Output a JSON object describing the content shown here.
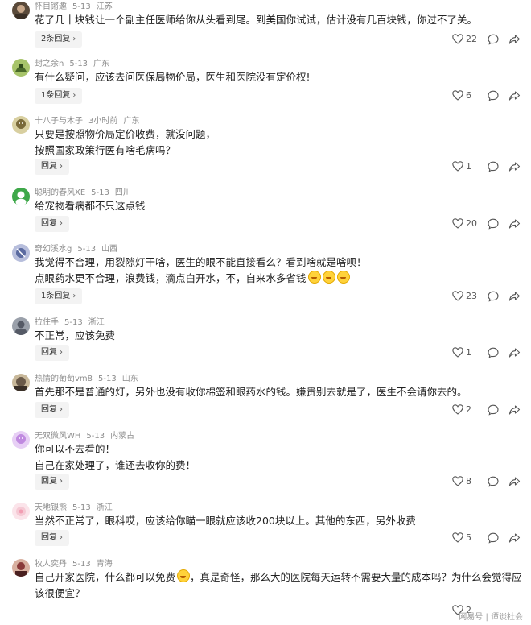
{
  "comments": [
    {
      "user": "怀目锵邀",
      "time": "5-13",
      "region": "江苏",
      "lines": [
        "花了几十块钱让一个副主任医师给你从头看到尾。到美国你试试，估计没有几百块钱，你过不了关。"
      ],
      "reply_label": "2条回复",
      "likes": "22",
      "avatar_color": "#5a4a3a"
    },
    {
      "user": "封之余n",
      "time": "5-13",
      "region": "广东",
      "lines": [
        "有什么疑问，应该去问医保局物价局，医生和医院没有定价权!"
      ],
      "reply_label": "1条回复",
      "likes": "6",
      "avatar_color": "#6b8e3a"
    },
    {
      "user": "十八子与木子",
      "time": "3小时前",
      "region": "广东",
      "lines": [
        "只要是按照物价局定价收费，就没问题，",
        "按照国家政策行医有啥毛病吗？"
      ],
      "reply_label": "回复",
      "likes": "1",
      "avatar_color": "#7a6a3a"
    },
    {
      "user": "聪明的春风XE",
      "time": "5-13",
      "region": "四川",
      "lines": [
        "给宠物看病都不只这点钱"
      ],
      "reply_label": "回复",
      "likes": "20",
      "avatar_color": "#3fa84a"
    },
    {
      "user": "奇幻溪水g",
      "time": "5-13",
      "region": "山西",
      "lines": [
        "我觉得不合理，用裂隙灯干啥，医生的眼不能直接看么？看到啥就是啥呗！",
        "点眼药水更不合理，浪费钱，滴点白开水，不，自来水多省钱"
      ],
      "emoji_count": 3,
      "reply_label": "1条回复",
      "likes": "23",
      "avatar_color": "#8a8fb0"
    },
    {
      "user": "拉住手",
      "time": "5-13",
      "region": "浙江",
      "lines": [
        "不正常，应该免费"
      ],
      "reply_label": "回复",
      "likes": "1",
      "avatar_color": "#555a66"
    },
    {
      "user": "热情的葡萄vm8",
      "time": "5-13",
      "region": "山东",
      "lines": [
        "首先那不是普通的灯，另外也没有收你棉签和眼药水的钱。嫌贵别去就是了，医生不会请你去的。"
      ],
      "reply_label": "回复",
      "likes": "2",
      "avatar_color": "#6a5a4a"
    },
    {
      "user": "无双微风WH",
      "time": "5-13",
      "region": "内蒙古",
      "lines": [
        "你可以不去看的！",
        "自己在家处理了，谁还去收你的费！"
      ],
      "reply_label": "回复",
      "likes": "8",
      "avatar_color": "#c08ae0"
    },
    {
      "user": "天地银熊",
      "time": "5-13",
      "region": "浙江",
      "lines": [
        "当然不正常了，眼科哎，应该给你瞄一眼就应该收200块以上。其他的东西，另外收费"
      ],
      "reply_label": "回复",
      "likes": "5",
      "avatar_color": "#f5c9d4"
    },
    {
      "user": "牧人奕丹",
      "time": "5-13",
      "region": "青海",
      "lines": [
        "自己开家医院，什么都可以免费",
        "该很便宜？"
      ],
      "line1_tail": "，真是奇怪，那么大的医院每天运转不需要大量的成本吗？为什么会觉得应",
      "reply_label": "",
      "likes": "2",
      "avatar_color": "#8a3a3a"
    }
  ],
  "watermark": "网易号 | 谭谈社会",
  "icons": [
    "like-icon",
    "comment-icon",
    "share-icon",
    "chevron-right-icon"
  ]
}
